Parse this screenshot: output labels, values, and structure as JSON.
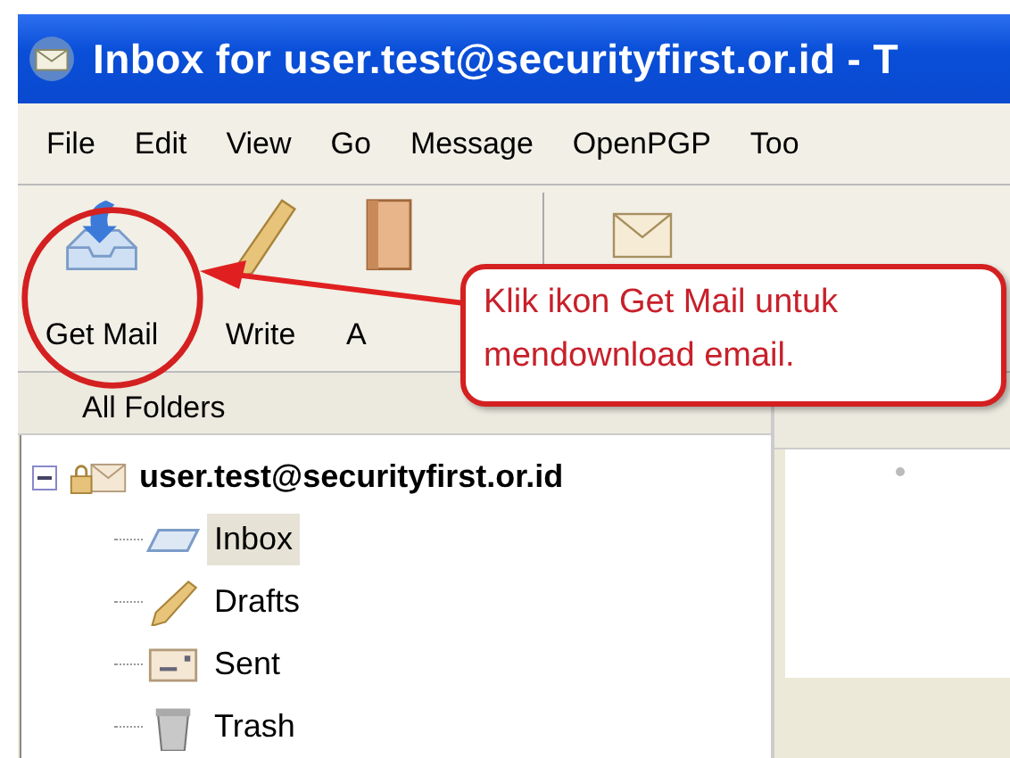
{
  "window": {
    "title": "Inbox for user.test@securityfirst.or.id - T"
  },
  "menu": [
    "File",
    "Edit",
    "View",
    "Go",
    "Message",
    "OpenPGP",
    "Too"
  ],
  "toolbar": [
    {
      "kind": "get-mail",
      "label": "Get Mail"
    },
    {
      "kind": "write",
      "label": "Write"
    },
    {
      "kind": "address-book",
      "label": "A"
    },
    {
      "kind": "separator"
    },
    {
      "kind": "envelope"
    }
  ],
  "folder_pane": {
    "header": "All Folders",
    "account": {
      "label": "user.test@securityfirst.or.id",
      "expanded": true,
      "children": [
        {
          "kind": "inbox",
          "label": "Inbox",
          "selected": true
        },
        {
          "kind": "drafts",
          "label": "Drafts",
          "selected": false
        },
        {
          "kind": "sent",
          "label": "Sent",
          "selected": false
        },
        {
          "kind": "trash",
          "label": "Trash",
          "selected": false
        }
      ]
    }
  },
  "callout": {
    "text": "Klik ikon Get Mail untuk mendownload email."
  }
}
